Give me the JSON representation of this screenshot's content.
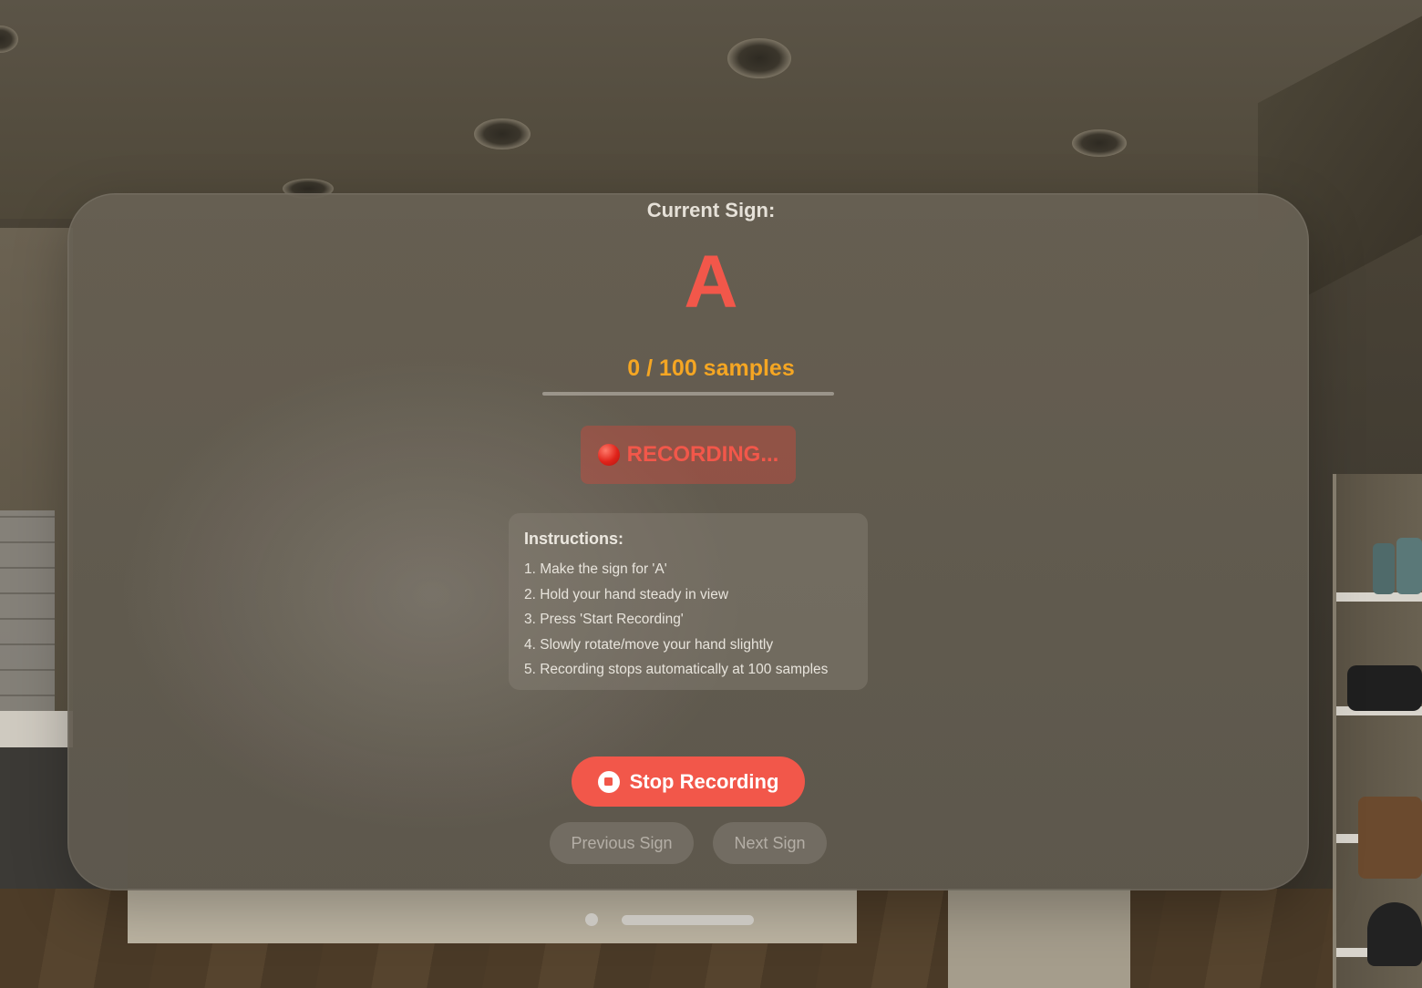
{
  "sign": {
    "header": "Current Sign:",
    "letter": "A"
  },
  "progress": {
    "label": "0 / 100 samples",
    "current": 0,
    "total": 100
  },
  "status": {
    "text": "RECORDING...",
    "icon": "red-circle-icon"
  },
  "instructions": {
    "title": "Instructions:",
    "steps": [
      "1. Make the sign for 'A'",
      "2. Hold your hand steady in view",
      "3. Press 'Start Recording'",
      "4. Slowly rotate/move your hand slightly",
      "5. Recording stops automatically at 100 samples"
    ]
  },
  "controls": {
    "stop_label": "Stop Recording",
    "stop_icon": "stop-circle-icon",
    "previous_label": "Previous Sign",
    "next_label": "Next Sign"
  },
  "colors": {
    "accent_red": "#f2574a",
    "progress_orange": "#f5a623"
  }
}
